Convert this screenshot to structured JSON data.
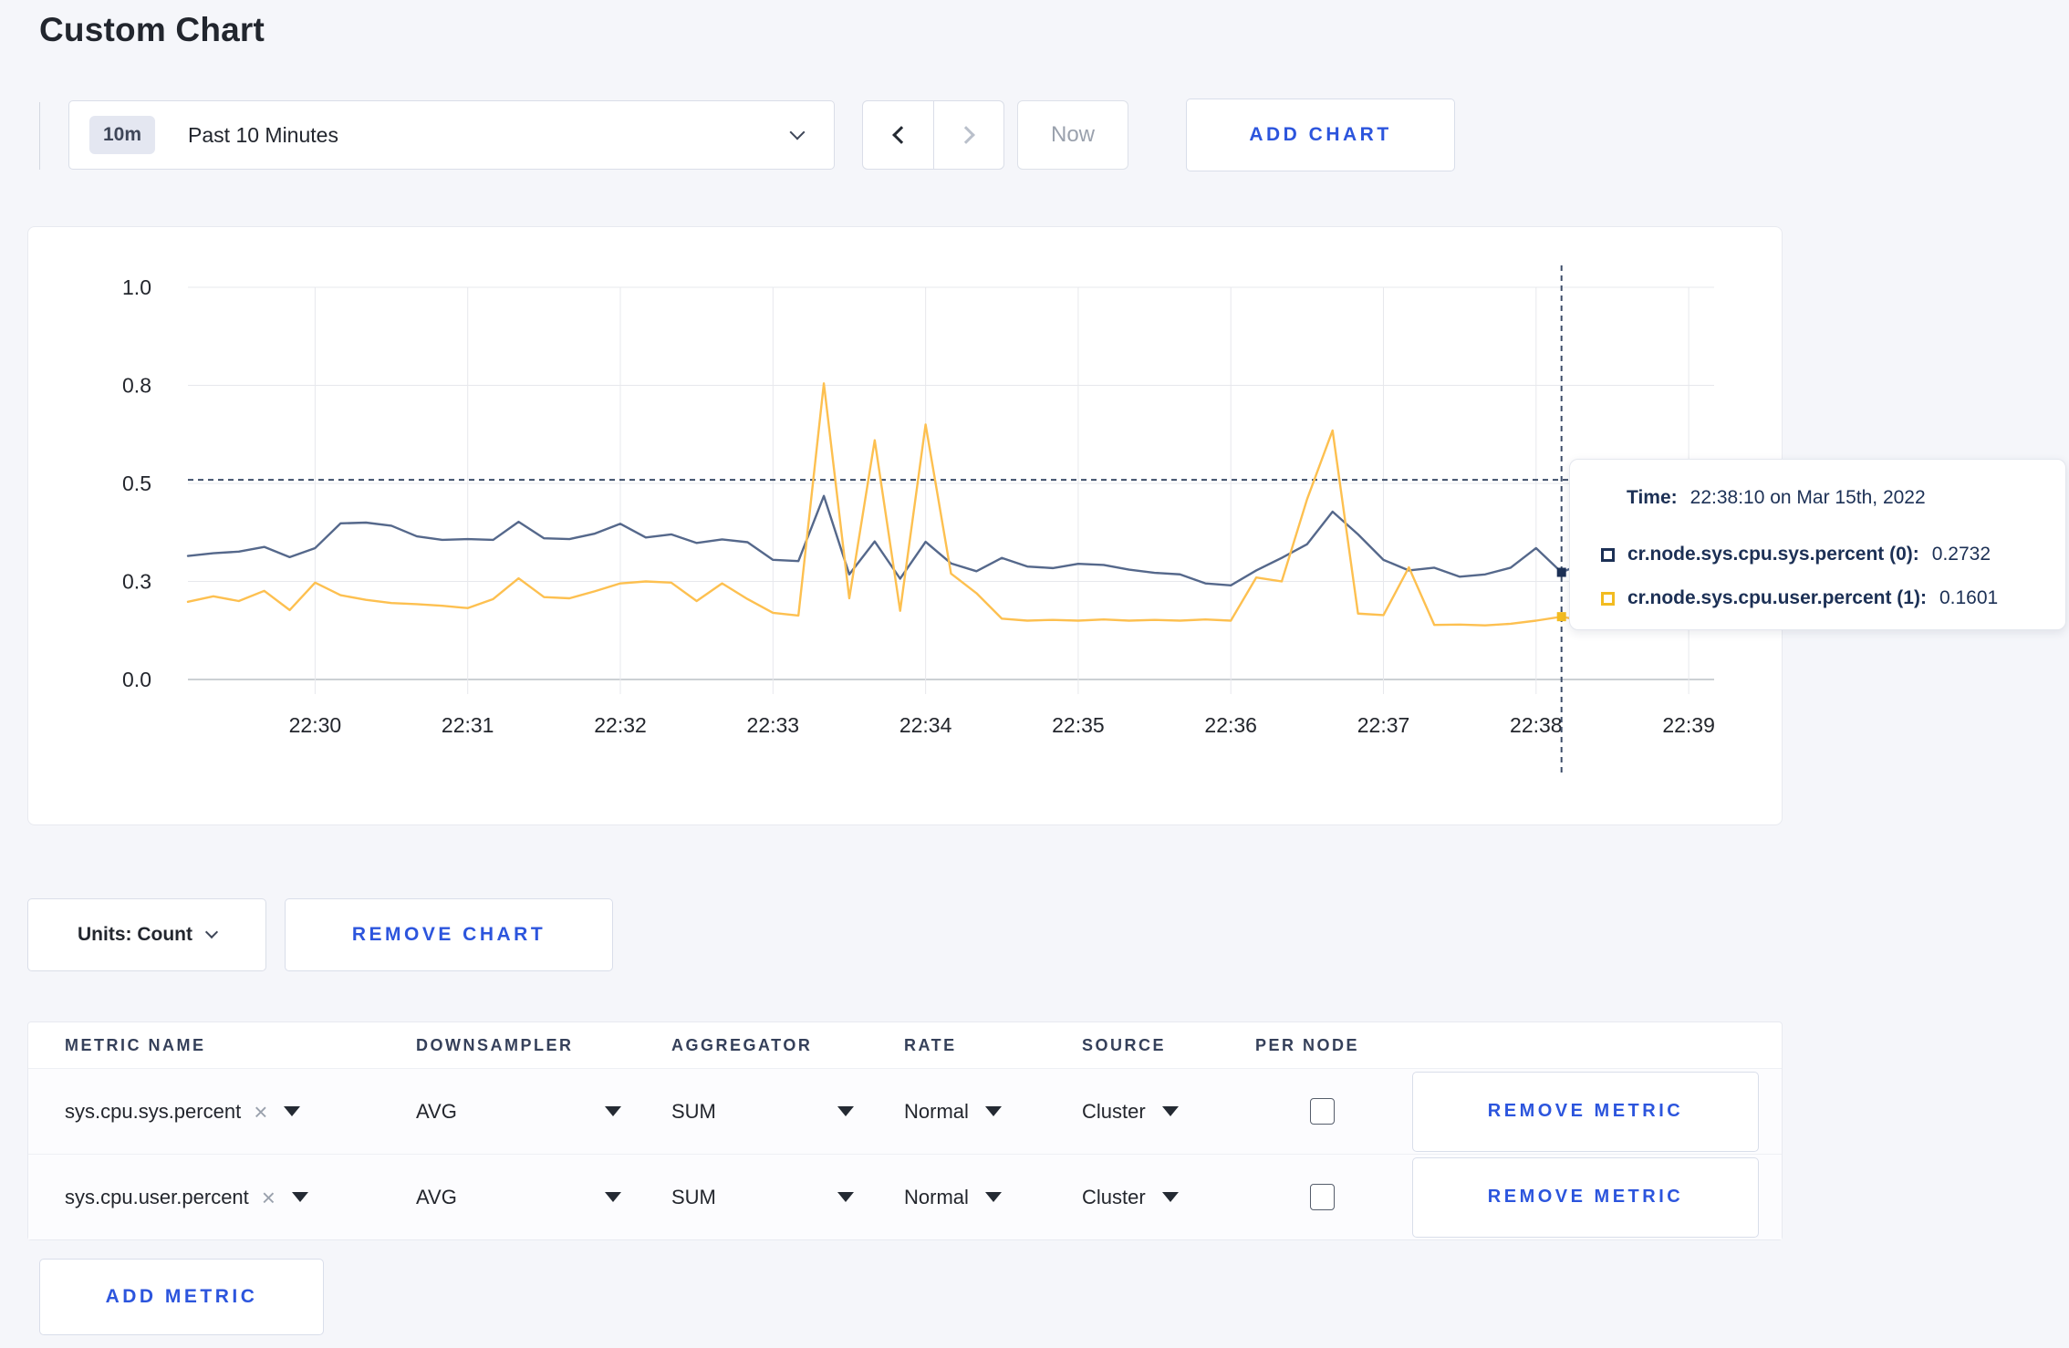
{
  "header": {
    "title": "Custom Chart"
  },
  "toolbar": {
    "range_badge": "10m",
    "range_label": "Past 10 Minutes",
    "prev_icon": "chevron-left",
    "next_icon": "chevron-right",
    "now_label": "Now",
    "add_chart_label": "ADD CHART"
  },
  "colors": {
    "accent_blue": "#2c55dd",
    "tooltip_navy": "#1c3055",
    "series_sys": "#55688b",
    "series_user": "#fdc050",
    "page_bg": "#f5f6fa"
  },
  "chart_data": {
    "type": "line",
    "title": "",
    "xlabel": "",
    "ylabel": "",
    "ylim": [
      0,
      1
    ],
    "grid": true,
    "x_start_time": "22:29:10",
    "x_step_seconds": 10,
    "y_axis": {
      "ticks": [
        {
          "value": 0.0,
          "label": "0.0"
        },
        {
          "value": 0.25,
          "label": "0.3"
        },
        {
          "value": 0.5,
          "label": "0.5"
        },
        {
          "value": 0.75,
          "label": "0.8"
        },
        {
          "value": 1.0,
          "label": "1.0"
        }
      ]
    },
    "x_axis": {
      "ticks": [
        {
          "index": 5,
          "label": "22:30"
        },
        {
          "index": 11,
          "label": "22:31"
        },
        {
          "index": 17,
          "label": "22:32"
        },
        {
          "index": 23,
          "label": "22:33"
        },
        {
          "index": 29,
          "label": "22:34"
        },
        {
          "index": 35,
          "label": "22:35"
        },
        {
          "index": 41,
          "label": "22:36"
        },
        {
          "index": 47,
          "label": "22:37"
        },
        {
          "index": 53,
          "label": "22:38"
        },
        {
          "index": 59,
          "label": "22:39"
        }
      ]
    },
    "series": [
      {
        "name": "cr.node.sys.cpu.sys.percent (0)",
        "color": "#55688b",
        "swatch_color": "#1c3055",
        "values": [
          0.315,
          0.322,
          0.326,
          0.338,
          0.312,
          0.335,
          0.398,
          0.4,
          0.392,
          0.365,
          0.356,
          0.358,
          0.356,
          0.402,
          0.36,
          0.358,
          0.372,
          0.397,
          0.362,
          0.37,
          0.348,
          0.357,
          0.35,
          0.305,
          0.302,
          0.468,
          0.268,
          0.352,
          0.257,
          0.351,
          0.296,
          0.276,
          0.31,
          0.288,
          0.284,
          0.295,
          0.292,
          0.28,
          0.272,
          0.268,
          0.245,
          0.24,
          0.278,
          0.31,
          0.345,
          0.428,
          0.37,
          0.305,
          0.278,
          0.285,
          0.262,
          0.268,
          0.285,
          0.335,
          0.2732,
          0.3,
          0.298,
          0.3,
          0.315,
          0.298,
          0.305
        ]
      },
      {
        "name": "cr.node.sys.cpu.user.percent (1)",
        "color": "#fdc050",
        "swatch_color": "#f2bb20",
        "values": [
          0.198,
          0.212,
          0.2,
          0.226,
          0.177,
          0.247,
          0.215,
          0.203,
          0.195,
          0.192,
          0.188,
          0.182,
          0.205,
          0.258,
          0.21,
          0.207,
          0.225,
          0.245,
          0.25,
          0.247,
          0.2,
          0.245,
          0.205,
          0.17,
          0.163,
          0.755,
          0.207,
          0.61,
          0.175,
          0.65,
          0.27,
          0.22,
          0.155,
          0.15,
          0.152,
          0.15,
          0.153,
          0.15,
          0.152,
          0.15,
          0.153,
          0.15,
          0.26,
          0.25,
          0.46,
          0.635,
          0.168,
          0.164,
          0.286,
          0.139,
          0.14,
          0.138,
          0.142,
          0.15,
          0.1601,
          0.148,
          0.147,
          0.15,
          0.215,
          0.27,
          0.24
        ]
      }
    ],
    "crosshair": {
      "index": 54,
      "y_value": 0.509
    },
    "legend_position": "tooltip"
  },
  "tooltip": {
    "time_label": "Time:",
    "time_value": "22:38:10 on Mar 15th, 2022",
    "rows": [
      {
        "label": "cr.node.sys.cpu.sys.percent (0):",
        "value": "0.2732"
      },
      {
        "label": "cr.node.sys.cpu.user.percent (1):",
        "value": "0.1601"
      }
    ]
  },
  "units_row": {
    "units_label": "Units: Count",
    "remove_chart_label": "REMOVE CHART"
  },
  "table": {
    "headers": [
      "METRIC NAME",
      "DOWNSAMPLER",
      "AGGREGATOR",
      "RATE",
      "SOURCE",
      "PER NODE"
    ],
    "rows": [
      {
        "metric": "sys.cpu.sys.percent",
        "downsampler": "AVG",
        "aggregator": "SUM",
        "rate": "Normal",
        "source": "Cluster",
        "per_node_checked": false,
        "remove_label": "REMOVE METRIC"
      },
      {
        "metric": "sys.cpu.user.percent",
        "downsampler": "AVG",
        "aggregator": "SUM",
        "rate": "Normal",
        "source": "Cluster",
        "per_node_checked": false,
        "remove_label": "REMOVE METRIC"
      }
    ],
    "add_metric_label": "ADD METRIC"
  },
  "icons": {
    "remove": "×"
  }
}
